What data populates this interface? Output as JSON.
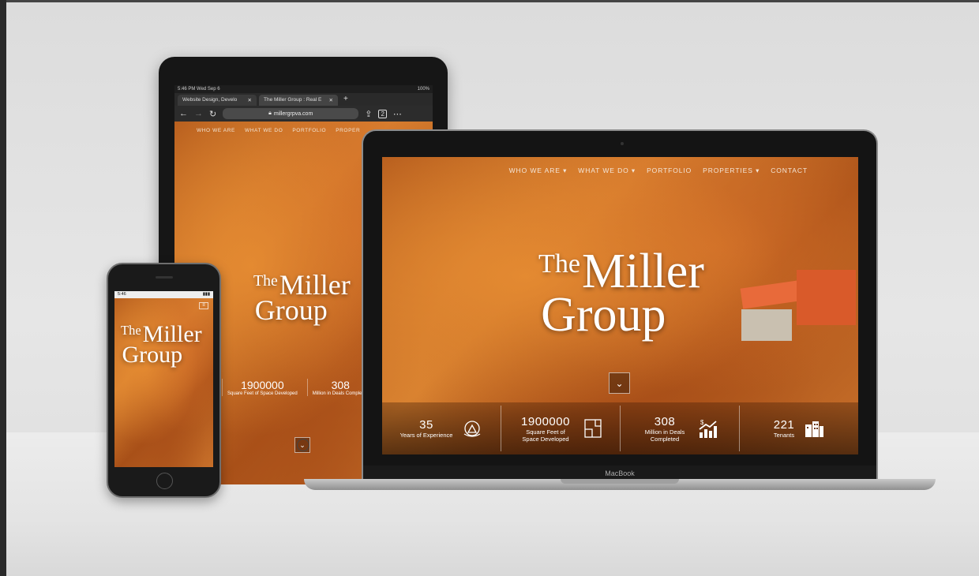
{
  "site": {
    "logo": {
      "the": "The",
      "miller": "Miller",
      "group": "Group"
    },
    "nav": [
      "WHO WE ARE",
      "WHAT WE DO",
      "PORTFOLIO",
      "PROPERTIES",
      "CONTACT"
    ],
    "scroll_icon": "chevron-down-icon"
  },
  "stats": [
    {
      "number": "35",
      "label": "Years of Experience",
      "icon": "experience-icon"
    },
    {
      "number": "1900000",
      "label": "Square Feet of Space Developed",
      "icon": "floorplan-icon"
    },
    {
      "number": "308",
      "label": "Million in Deals Completed",
      "icon": "growth-chart-icon"
    },
    {
      "number": "221",
      "label": "Tenants",
      "icon": "building-icon"
    }
  ],
  "tablet": {
    "status_time": "5:46 PM  Wed Sep 6",
    "battery": "100%",
    "tabs": [
      {
        "label": "Website Design, Develo"
      },
      {
        "label": "The Miller Group : Real E"
      }
    ],
    "url": "millergrpva.com",
    "nav": [
      "WHO WE ARE",
      "WHAT WE DO",
      "PORTFOLIO",
      "PROPER"
    ],
    "stats": [
      {
        "number": "1900000",
        "label": "Square Feet of Space Developed"
      },
      {
        "number": "308",
        "label": "Million in Deals Completed"
      }
    ]
  },
  "laptop": {
    "brand": "MacBook"
  },
  "phone": {
    "status_time": "5:46"
  },
  "colors": {
    "hero_orange": "#c8702a",
    "logo_white": "#ffffff",
    "device_black": "#161616"
  }
}
